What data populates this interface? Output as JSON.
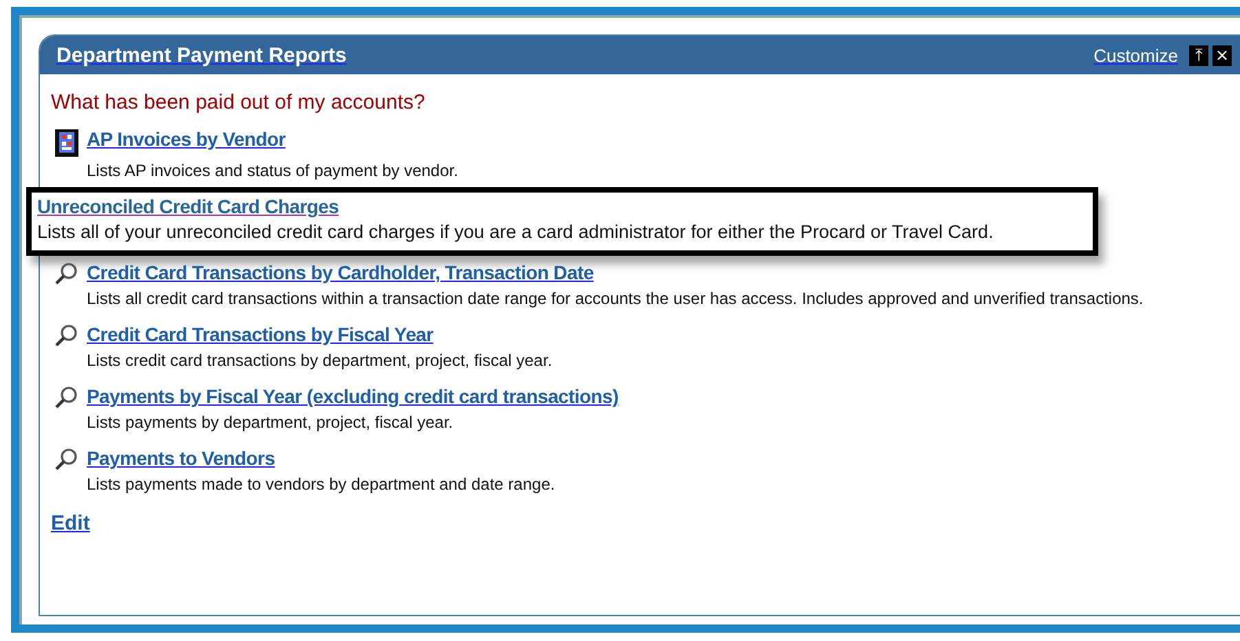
{
  "portlet": {
    "title": "Department Payment Reports",
    "customize": "Customize",
    "pin_button": "⤒",
    "close_button": "×"
  },
  "question": "What has been paid out of my accounts?",
  "reports": [
    {
      "kind": "invoice",
      "link": "AP Invoices by Vendor",
      "description": "Lists AP invoices and status of payment by vendor."
    },
    {
      "kind": "highlighted",
      "link": "Unreconciled Credit Card Charges",
      "description": "Lists all of your unreconciled credit card charges if you are a card administrator for either the Procard or Travel Card."
    },
    {
      "kind": "search",
      "link": "Credit Card Transactions by Cardholder, Transaction Date",
      "description": "Lists all credit card transactions within a transaction date range for accounts the user has access. Includes approved and unverified transactions."
    },
    {
      "kind": "search",
      "link": "Credit Card Transactions by Fiscal Year",
      "description": "Lists credit card transactions by department, project, fiscal year."
    },
    {
      "kind": "search",
      "link": "Payments by Fiscal Year (excluding credit card transactions)",
      "description": "Lists payments by department, project, fiscal year."
    },
    {
      "kind": "search",
      "link": "Payments to Vendors",
      "description": "Lists payments made to vendors by department and date range."
    }
  ],
  "edit_link": "Edit"
}
